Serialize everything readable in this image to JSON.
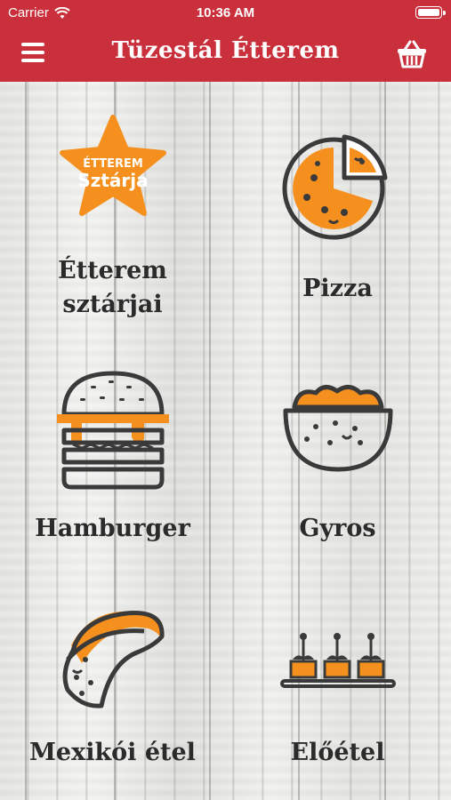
{
  "status_bar": {
    "carrier": "Carrier",
    "time": "10:36 AM"
  },
  "nav": {
    "title": "Tüzestál Étterem",
    "menu_icon": "hamburger-menu-icon",
    "cart_icon": "basket-icon"
  },
  "colors": {
    "brand_red": "#c9303c",
    "accent_orange": "#f5901e",
    "icon_dark": "#3a3a3a",
    "text_dark": "#2b2b2b"
  },
  "categories": [
    {
      "label": "Étterem sztárjai",
      "icon": "star-badge-icon",
      "badge_text_1": "ÉTTEREM",
      "badge_text_2": "Sztárja"
    },
    {
      "label": "Pizza",
      "icon": "pizza-icon"
    },
    {
      "label": "Hamburger",
      "icon": "hamburger-icon"
    },
    {
      "label": "Gyros",
      "icon": "gyros-bowl-icon"
    },
    {
      "label": "Mexikói étel",
      "icon": "taco-icon"
    },
    {
      "label": "Előétel",
      "icon": "appetizer-skewers-icon"
    }
  ]
}
